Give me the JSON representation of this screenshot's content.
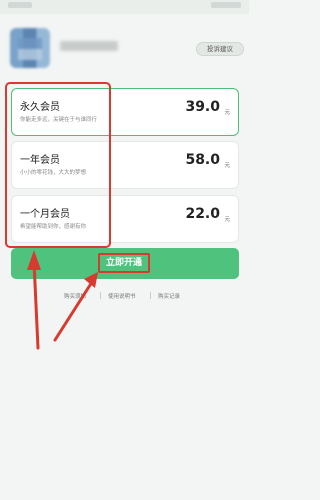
{
  "header": {
    "feedback_label": "投诉建议"
  },
  "plans": [
    {
      "title": "永久会员",
      "desc": "你能走多远，关键在于与谁同行",
      "price": "39.0",
      "unit": "元"
    },
    {
      "title": "一年会员",
      "desc": "小小的零花钱，大大的梦想",
      "price": "58.0",
      "unit": "元"
    },
    {
      "title": "一个月会员",
      "desc": "希望能帮助到你，感谢有你",
      "price": "22.0",
      "unit": "元"
    }
  ],
  "action": {
    "open_label": "立即开通"
  },
  "footer_links": [
    "购买须知",
    "使用说明书",
    "购买记录"
  ],
  "colors": {
    "accent": "#4fc27e",
    "annotation": "#d93a2f",
    "background": "#f3f5f4"
  }
}
